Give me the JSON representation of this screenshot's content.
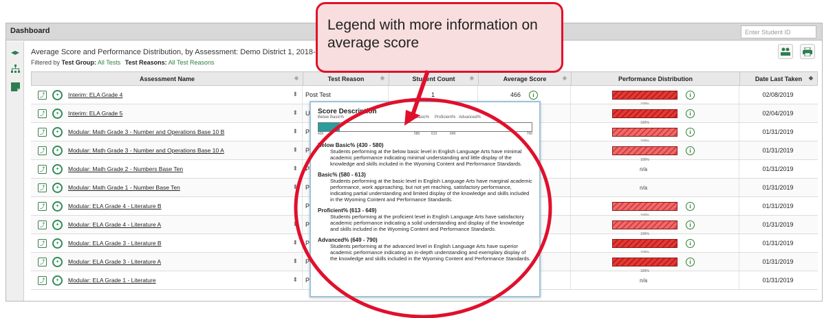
{
  "topbar": {
    "title": "Dashboard",
    "student_placeholder": "Enter Student ID"
  },
  "report": {
    "title": "Average Score and Performance Distribution, by Assessment: Demo District 1, 2018-2019",
    "filter_prefix": "Filtered by",
    "filter_group_label": "Test Group:",
    "filter_group_value": "All Tests",
    "filter_reason_label": "Test Reasons:",
    "filter_reason_value": "All Test Reasons"
  },
  "columns": [
    "Assessment Name",
    "Test Reason",
    "Student Count",
    "Average Score",
    "Performance Distribution",
    "Date Last Taken"
  ],
  "rows": [
    {
      "name": "Interim: ELA Grade 4",
      "reason": "Post Test",
      "count": "1",
      "score": "466",
      "perf": "bar",
      "pct": "100%",
      "date": "02/08/2019"
    },
    {
      "name": "Interim: ELA Grade 5",
      "reason": "Unas",
      "count": "",
      "score": "",
      "perf": "bar",
      "pct": "100%",
      "date": "02/04/2019"
    },
    {
      "name": "Modular: Math Grade 3 - Number and Operations Base 10 B",
      "reason": "Post",
      "count": "",
      "score": "",
      "perf": "bar-light",
      "pct": "100%",
      "date": "01/31/2019"
    },
    {
      "name": "Modular: Math Grade 3 - Number and Operations Base 10 A",
      "reason": "Post",
      "count": "",
      "score": "",
      "perf": "bar-light",
      "pct": "100%",
      "date": "01/31/2019"
    },
    {
      "name": "Modular: Math Grade 2 - Numbers Base Ten",
      "reason": "Post",
      "count": "",
      "score": "",
      "perf": "na",
      "pct": "n/a",
      "date": "01/31/2019"
    },
    {
      "name": "Modular: Math Grade 1 - Number Base Ten",
      "reason": "Post",
      "count": "",
      "score": "",
      "perf": "na",
      "pct": "n/a",
      "date": "01/31/2019"
    },
    {
      "name": "Modular: ELA Grade 4 - Literature B",
      "reason": "Post",
      "count": "",
      "score": "",
      "perf": "bar-light",
      "pct": "100%",
      "date": "01/31/2019"
    },
    {
      "name": "Modular: ELA Grade 4 - Literature A",
      "reason": "Post",
      "count": "",
      "score": "",
      "perf": "bar-light",
      "pct": "100%",
      "date": "01/31/2019"
    },
    {
      "name": "Modular: ELA Grade 3 - Literature B",
      "reason": "Post",
      "count": "",
      "score": "",
      "perf": "bar",
      "pct": "100%",
      "date": "01/31/2019"
    },
    {
      "name": "Modular: ELA Grade 3 - Literature A",
      "reason": "Post",
      "count": "",
      "score": "",
      "perf": "bar",
      "pct": "100%",
      "date": "01/31/2019"
    },
    {
      "name": "Modular: ELA Grade 1 - Literature",
      "reason": "Post",
      "count": "",
      "score": "",
      "perf": "na",
      "pct": "n/a",
      "date": "01/31/2019"
    }
  ],
  "popover": {
    "title": "Score Description",
    "scale_labels": [
      "Below Basic%",
      "Basic%",
      "Proficient%",
      "Advanced%"
    ],
    "ticks": [
      "430",
      "580",
      "613",
      "649",
      "790"
    ],
    "fill_fraction": 0.1,
    "fill_color": "#2a9d9f",
    "levels": [
      {
        "heading": "Below Basic% (430 - 580)",
        "text": "Students performing at the below basic level in English Language Arts have minimal academic performance indicating minimal understanding and little display of the knowledge and skills included in the Wyoming Content and Performance Standards."
      },
      {
        "heading": "Basic% (580 - 613)",
        "text": "Students performing at the basic level in English Language Arts have marginal academic performance, work approaching, but not yet reaching, satisfactory performance, indicating partial understanding and limited display of the knowledge and skills included in the Wyoming Content and Performance Standards."
      },
      {
        "heading": "Proficient% (613 - 649)",
        "text": "Students performing at the proficient level in English Language Arts have satisfactory academic performance indicating a solid understanding and display of the knowledge and skills included in the Wyoming Content and Performance Standards."
      },
      {
        "heading": "Advanced% (649 - 790)",
        "text": "Students performing at the advanced level in English Language Arts have superior academic performance indicating an in-depth understanding and exemplary display of the knowledge and skills included in the Wyoming Content and Performance Standards."
      }
    ]
  },
  "callout": {
    "text": "Legend with more information on average score",
    "color": "#e0102c"
  },
  "colors": {
    "accent_green": "#2e7d4f",
    "bar_red": "#e53935",
    "popover_border": "#9cc3dc"
  }
}
